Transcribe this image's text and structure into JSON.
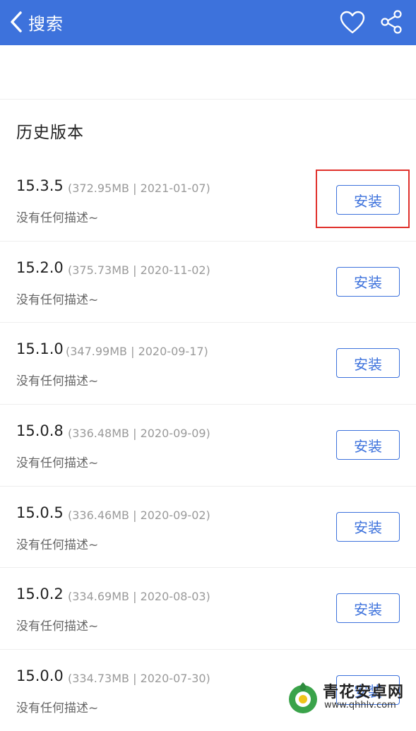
{
  "header": {
    "back_label": "搜索",
    "background_color": "#3d72dc",
    "icons": [
      "chevron-left-icon",
      "heart-icon",
      "share-icon"
    ]
  },
  "section": {
    "title": "历史版本"
  },
  "versions": [
    {
      "version": "15.3.5",
      "meta": "(372.95MB | 2021-01-07)",
      "description": "没有任何描述~",
      "button": "安装"
    },
    {
      "version": "15.2.0",
      "meta": "(375.73MB | 2020-11-02)",
      "description": "没有任何描述~",
      "button": "安装"
    },
    {
      "version": "15.1.0",
      "meta": "(347.99MB | 2020-09-17)",
      "description": "没有任何描述~",
      "button": "安装"
    },
    {
      "version": "15.0.8",
      "meta": "(336.48MB | 2020-09-09)",
      "description": "没有任何描述~",
      "button": "安装"
    },
    {
      "version": "15.0.5",
      "meta": "(336.46MB | 2020-09-02)",
      "description": "没有任何描述~",
      "button": "安装"
    },
    {
      "version": "15.0.2",
      "meta": "(334.69MB | 2020-08-03)",
      "description": "没有任何描述~",
      "button": "安装"
    },
    {
      "version": "15.0.0",
      "meta": "(334.73MB | 2020-07-30)",
      "description": "没有任何描述~",
      "button": "安装"
    }
  ],
  "highlight": {
    "color": "#e0312c",
    "target": "15.3.5 安装"
  },
  "watermark": {
    "name": "青花安卓网",
    "url": "www.qhhlv.com"
  }
}
